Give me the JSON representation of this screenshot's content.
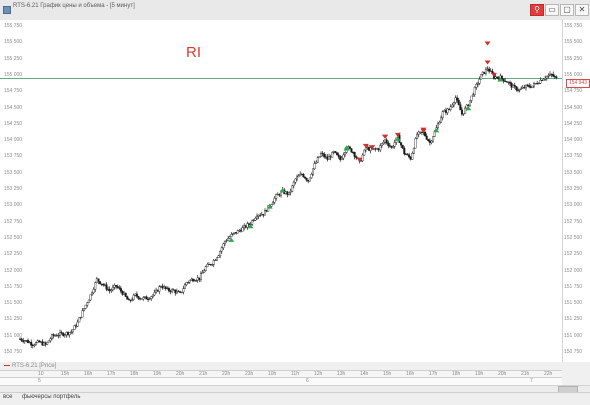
{
  "window": {
    "title": "RTS-6.21 График цены и объема - [5 минут]",
    "buttons": {
      "pin": "⚲",
      "minimize": "▭",
      "maximize": "▢",
      "close": "✕"
    }
  },
  "chart": {
    "title": "RI",
    "instrument_legend": "RTS-6.21 [Price]",
    "current_price": "154 943",
    "level_line_price": 154943,
    "y_axis_ticks": [
      "155 750",
      "155 500",
      "155 250",
      "155 000",
      "154 750",
      "154 500",
      "154 250",
      "154 000",
      "153 750",
      "153 500",
      "153 250",
      "153 000",
      "152 750",
      "152 500",
      "152 250",
      "152 000",
      "151 750",
      "151 500",
      "151 250",
      "151 000",
      "150 750"
    ],
    "time_ticks": [
      "10",
      "15h",
      "16h",
      "17h",
      "18h",
      "19h",
      "20h",
      "21h",
      "22h",
      "23h",
      "10h",
      "11h",
      "12h",
      "13h",
      "14h",
      "15h",
      "16h",
      "17h",
      "18h",
      "19h",
      "20h",
      "21h",
      "22h"
    ],
    "date_ticks": [
      "5",
      "6",
      "7"
    ],
    "colors": {
      "candle": "#1a1a1a",
      "level_line": "#2e8b57",
      "sell_marker": "#d62b2b",
      "buy_marker": "#2ea84a",
      "title": "#dc3b2c"
    }
  },
  "chart_data": {
    "type": "line",
    "title": "RI",
    "ylim": [
      150750,
      155750
    ],
    "series": [
      {
        "name": "RTS-6.21 [Price]",
        "values": [
          150950,
          150920,
          150870,
          150900,
          150860,
          150990,
          151020,
          151030,
          151060,
          151200,
          151420,
          151620,
          151860,
          151780,
          151690,
          151760,
          151660,
          151520,
          151620,
          151570,
          151580,
          151640,
          151770,
          151700,
          151690,
          151640,
          151820,
          151870,
          151880,
          152050,
          152120,
          152250,
          152450,
          152540,
          152600,
          152660,
          152730,
          152860,
          152870,
          153000,
          153140,
          153210,
          153170,
          153400,
          153480,
          153380,
          153620,
          153790,
          153710,
          153810,
          153700,
          153890,
          153820,
          153650,
          153880,
          153850,
          153870,
          154000,
          153880,
          154050,
          153800,
          153720,
          154090,
          154110,
          153960,
          154180,
          154420,
          154470,
          154650,
          154400,
          154550,
          154780,
          154990,
          155100,
          154970,
          154960,
          154900,
          154810,
          154770,
          154820,
          154830,
          154900,
          154970,
          155000,
          154920
        ]
      }
    ],
    "sell_markers": [
      153670,
      153880,
      154020,
      154130,
      154050,
      153860,
      154110,
      154020,
      154970,
      155160,
      155450
    ],
    "buy_markers": [
      152500,
      152710,
      153010,
      153260,
      153900,
      153920,
      154050,
      154180,
      154520,
      154960
    ]
  },
  "statusbar": {
    "tab1": "все",
    "tab2": "фьючерсы портфель"
  }
}
